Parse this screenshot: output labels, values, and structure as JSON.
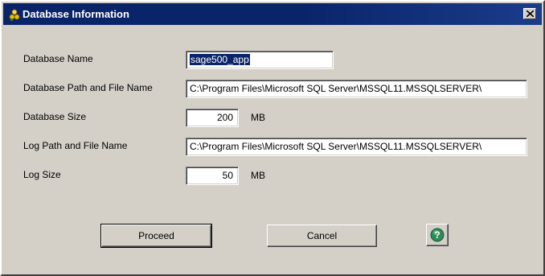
{
  "window": {
    "title": "Database Information",
    "app_icon": "database-icon",
    "close_icon": "close-icon"
  },
  "form": {
    "db_name_label": "Database Name",
    "db_name_value": "sage500_app",
    "db_path_label": "Database Path and File Name",
    "db_path_value": "C:\\Program Files\\Microsoft SQL Server\\MSSQL11.MSSQLSERVER\\",
    "db_size_label": "Database Size",
    "db_size_value": "200",
    "db_size_unit": "MB",
    "log_path_label": "Log Path and File Name",
    "log_path_value": "C:\\Program Files\\Microsoft SQL Server\\MSSQL11.MSSQLSERVER\\",
    "log_size_label": "Log Size",
    "log_size_value": "50",
    "log_size_unit": "MB"
  },
  "buttons": {
    "proceed_label": "Proceed",
    "cancel_label": "Cancel",
    "help_icon": "help-icon"
  },
  "colors": {
    "titlebar": "#0a246a",
    "face": "#d4d0c8",
    "help_green": "#2e8b57"
  }
}
